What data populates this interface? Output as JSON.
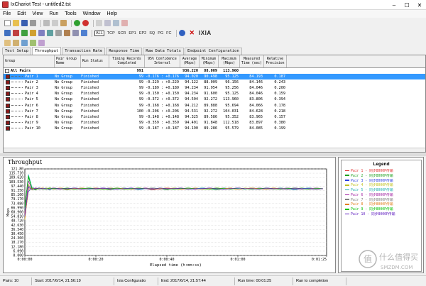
{
  "window": {
    "title": "IxChariot Test - untitled2.tst"
  },
  "menu": [
    "File",
    "Edit",
    "View",
    "Run",
    "Tools",
    "Window",
    "Help"
  ],
  "filter_buttons": [
    "ALL",
    "TCP",
    "SCR",
    "EP1",
    "EP2",
    "SQ",
    "PG",
    "FC"
  ],
  "brand": "IXIA",
  "tabs": [
    "Test Setup",
    "Throughput",
    "Transaction Rate",
    "Response Time",
    "Raw Data Totals",
    "Endpoint Configuration"
  ],
  "active_tab": "Throughput",
  "grid": {
    "headers": {
      "group": "Group",
      "pair_group_name": "Pair Group\nName",
      "run_status": "Run Status",
      "timing_records": "Timing Records\nCompleted",
      "confidence": "95% Confidence\nInterval",
      "average": "Average\n(Mbps)",
      "minimum": "Minimum\n(Mbps)",
      "maximum": "Maximum\n(Mbps)",
      "measured_time": "Measured\nTime (sec)",
      "relative_precision": "Relative\nPrecision"
    },
    "all_pairs": {
      "label": "All Pairs",
      "records": "991",
      "average": "936.220",
      "minimum": "88.009",
      "maximum": "113.960"
    },
    "rows": [
      {
        "name": "Pair 1",
        "group": "No Group",
        "status": "Finished",
        "records": "99",
        "ci": "-0.176 : +0.176",
        "avg": "94.020",
        "min": "90.498",
        "max": "95.125",
        "time": "84.193",
        "prec": "0.187"
      },
      {
        "name": "Pair 2",
        "group": "No Group",
        "status": "Finished",
        "records": "99",
        "ci": "-0.229 : +0.229",
        "avg": "94.122",
        "min": "88.009",
        "max": "96.156",
        "time": "84.146",
        "prec": "0.243"
      },
      {
        "name": "Pair 3",
        "group": "No Group",
        "status": "Finished",
        "records": "99",
        "ci": "-0.189 : +0.189",
        "avg": "94.234",
        "min": "91.954",
        "max": "95.256",
        "time": "84.046",
        "prec": "0.200"
      },
      {
        "name": "Pair 4",
        "group": "No Group",
        "status": "Finished",
        "records": "99",
        "ci": "-0.150 : +0.150",
        "avg": "94.234",
        "min": "91.600",
        "max": "95.125",
        "time": "84.046",
        "prec": "0.159"
      },
      {
        "name": "Pair 5",
        "group": "No Group",
        "status": "Finished",
        "records": "99",
        "ci": "-0.372 : +0.372",
        "avg": "94.504",
        "min": "92.272",
        "max": "113.960",
        "time": "83.806",
        "prec": "0.394"
      },
      {
        "name": "Pair 6",
        "group": "No Group",
        "status": "Finished",
        "records": "99",
        "ci": "-0.168 : +0.168",
        "avg": "94.212",
        "min": "89.888",
        "max": "95.694",
        "time": "84.066",
        "prec": "0.178"
      },
      {
        "name": "Pair 7",
        "group": "No Group",
        "status": "Finished",
        "records": "100",
        "ci": "-0.206 : +0.206",
        "avg": "94.531",
        "min": "92.272",
        "max": "104.031",
        "time": "84.628",
        "prec": "0.218"
      },
      {
        "name": "Pair 8",
        "group": "No Group",
        "status": "Finished",
        "records": "99",
        "ci": "-0.148 : +0.148",
        "avg": "94.325",
        "min": "89.586",
        "max": "95.352",
        "time": "83.965",
        "prec": "0.157"
      },
      {
        "name": "Pair 9",
        "group": "No Group",
        "status": "Finished",
        "records": "99",
        "ci": "-0.359 : +0.359",
        "avg": "94.401",
        "min": "91.848",
        "max": "112.518",
        "time": "83.897",
        "prec": "0.380"
      },
      {
        "name": "Pair 10",
        "group": "No Group",
        "status": "Finished",
        "records": "99",
        "ci": "-0.187 : +0.187",
        "avg": "94.190",
        "min": "89.286",
        "max": "95.579",
        "time": "84.085",
        "prec": "0.199"
      }
    ]
  },
  "chart": {
    "title": "Throughput",
    "ylabel": "Mbps",
    "xlabel": "Elapsed time (h:mm:ss)",
    "yticks": [
      "121.80",
      "115.710",
      "109.620",
      "103.530",
      "97.440",
      "91.350",
      "85.260",
      "79.170",
      "73.080",
      "66.990",
      "60.900",
      "54.810",
      "48.720",
      "42.630",
      "36.540",
      "30.450",
      "24.360",
      "18.270",
      "12.180",
      "6.090",
      "0.000"
    ],
    "xticks": [
      "0:00:00",
      "0:00:20",
      "0:00:40",
      "0:01:00",
      "0:01:25"
    ]
  },
  "chart_data": {
    "type": "line",
    "title": "Throughput",
    "xlabel": "Elapsed time (h:mm:ss)",
    "ylabel": "Mbps",
    "ylim": [
      0,
      121.8
    ],
    "xlim": [
      0,
      85
    ],
    "x": [
      0,
      1,
      2,
      3,
      4,
      5,
      6,
      7,
      8,
      10,
      12,
      14,
      16,
      18,
      20,
      22,
      24,
      26,
      28,
      30,
      32,
      34,
      36,
      38,
      40,
      42,
      44,
      46,
      48,
      50,
      52,
      54,
      56,
      58,
      60,
      62,
      64,
      66,
      68,
      70,
      72,
      74,
      76,
      78,
      80,
      82,
      84
    ],
    "series": [
      {
        "color": "#e03030",
        "values": [
          60,
          95,
          94,
          93,
          94,
          95,
          94,
          93,
          94,
          95,
          94,
          93,
          95,
          94,
          93,
          94,
          95,
          94,
          93,
          94,
          95,
          94,
          92,
          94,
          95,
          94,
          93,
          94,
          95,
          94,
          93,
          94,
          95,
          94,
          93,
          94,
          95,
          94,
          93,
          94,
          95,
          94,
          93,
          94,
          95,
          94,
          94
        ]
      },
      {
        "color": "#20a020",
        "values": [
          70,
          110,
          94,
          92,
          95,
          93,
          94,
          95,
          93,
          94,
          92,
          95,
          94,
          93,
          95,
          94,
          92,
          94,
          95,
          93,
          94,
          95,
          93,
          94,
          92,
          95,
          94,
          93,
          94,
          95,
          94,
          92,
          94,
          95,
          93,
          94,
          95,
          94,
          93,
          95,
          94,
          93,
          94,
          95,
          94,
          93,
          94
        ]
      },
      {
        "color": "#3040e0",
        "values": [
          55,
          90,
          95,
          94,
          93,
          94,
          95,
          94,
          95,
          93,
          94,
          95,
          94,
          95,
          93,
          94,
          95,
          94,
          94,
          95,
          93,
          94,
          95,
          94,
          93,
          95,
          94,
          94,
          93,
          95,
          94,
          95,
          93,
          94,
          95,
          94,
          94,
          93,
          95,
          94,
          94,
          95,
          93,
          94,
          95,
          94,
          94
        ]
      },
      {
        "color": "#c0c020",
        "values": [
          50,
          100,
          92,
          95,
          94,
          93,
          95,
          94,
          93,
          95,
          94,
          94,
          93,
          95,
          94,
          93,
          95,
          94,
          93,
          94,
          95,
          94,
          95,
          93,
          94,
          95,
          94,
          93,
          95,
          94,
          93,
          95,
          94,
          94,
          93,
          95,
          94,
          93,
          94,
          95,
          93,
          94,
          95,
          94,
          93,
          95,
          94
        ]
      },
      {
        "color": "#20b0b0",
        "values": [
          65,
          114,
          96,
          94,
          93,
          95,
          94,
          92,
          95,
          94,
          93,
          94,
          95,
          93,
          94,
          95,
          94,
          93,
          95,
          94,
          92,
          94,
          95,
          94,
          93,
          94,
          95,
          93,
          94,
          95,
          94,
          93,
          95,
          94,
          94,
          93,
          95,
          94,
          93,
          94,
          95,
          94,
          92,
          94,
          95,
          94,
          94
        ]
      },
      {
        "color": "#a020a0",
        "values": [
          58,
          105,
          93,
          95,
          94,
          94,
          93,
          95,
          94,
          93,
          95,
          94,
          93,
          94,
          95,
          94,
          93,
          95,
          94,
          93,
          94,
          95,
          94,
          93,
          95,
          94,
          94,
          95,
          93,
          94,
          95,
          94,
          93,
          94,
          95,
          94,
          93,
          95,
          94,
          94,
          93,
          95,
          94,
          93,
          94,
          95,
          94
        ]
      },
      {
        "color": "#808080",
        "values": [
          62,
          98,
          94,
          94,
          95,
          93,
          94,
          94,
          95,
          94,
          93,
          95,
          94,
          94,
          93,
          95,
          94,
          94,
          95,
          93,
          94,
          94,
          95,
          94,
          93,
          94,
          95,
          94,
          94,
          93,
          95,
          94,
          94,
          95,
          93,
          94,
          94,
          95,
          94,
          93,
          94,
          95,
          94,
          94,
          93,
          95,
          94
        ]
      },
      {
        "color": "#e08020",
        "values": [
          52,
          92,
          95,
          93,
          94,
          95,
          93,
          94,
          95,
          94,
          93,
          94,
          95,
          94,
          95,
          93,
          94,
          95,
          94,
          93,
          95,
          94,
          93,
          94,
          95,
          94,
          93,
          95,
          94,
          93,
          94,
          95,
          94,
          95,
          93,
          94,
          95,
          94,
          93,
          95,
          94,
          93,
          95,
          94,
          94,
          93,
          94
        ]
      },
      {
        "color": "#00c000",
        "values": [
          68,
          112,
          94,
          93,
          95,
          94,
          93,
          95,
          94,
          94,
          95,
          93,
          94,
          95,
          94,
          93,
          94,
          95,
          93,
          94,
          95,
          94,
          93,
          95,
          94,
          93,
          94,
          95,
          94,
          94,
          93,
          95,
          94,
          93,
          95,
          94,
          93,
          94,
          95,
          94,
          93,
          94,
          95,
          94,
          93,
          94,
          94
        ]
      },
      {
        "color": "#6020c0",
        "values": [
          56,
          96,
          93,
          94,
          95,
          94,
          94,
          93,
          95,
          94,
          94,
          95,
          93,
          94,
          94,
          95,
          94,
          93,
          94,
          95,
          94,
          94,
          93,
          95,
          94,
          94,
          95,
          93,
          94,
          94,
          95,
          94,
          93,
          94,
          95,
          94,
          94,
          93,
          95,
          94,
          94,
          93,
          95,
          94,
          94,
          93,
          94
        ]
      }
    ]
  },
  "legend": {
    "title": "Legend",
    "items": [
      {
        "label": "Pair 1 - 同步8000P传输",
        "color": "#e03030"
      },
      {
        "label": "Pair 2 - 同步8000P传输",
        "color": "#20a020"
      },
      {
        "label": "Pair 3 - 同步8000P传输",
        "color": "#3040e0"
      },
      {
        "label": "Pair 4 - 同步8000P传输",
        "color": "#c0c020"
      },
      {
        "label": "Pair 5 - 同步8000P传输",
        "color": "#20b0b0"
      },
      {
        "label": "Pair 6 - 同步8000P传输",
        "color": "#a020a0"
      },
      {
        "label": "Pair 7 - 同步8000P传输",
        "color": "#808080"
      },
      {
        "label": "Pair 8 - 同步8000P传输",
        "color": "#e08020"
      },
      {
        "label": "Pair 9 - 同步8000P传输",
        "color": "#00c000"
      },
      {
        "label": "Pair 10 - 同步8000P传输",
        "color": "#6020c0"
      }
    ]
  },
  "status": {
    "pairs": "Pairs: 10",
    "start": "Start: 2017/6/14, 21:56:19",
    "config": "Ixia Configuratio",
    "end": "End: 2017/6/14, 21:57:44",
    "run_time": "Run time: 00:01:25",
    "completion": "Ran to completion"
  },
  "watermark": {
    "glyph": "值",
    "text": "什么值得买",
    "site": "SMZDM.COM"
  }
}
